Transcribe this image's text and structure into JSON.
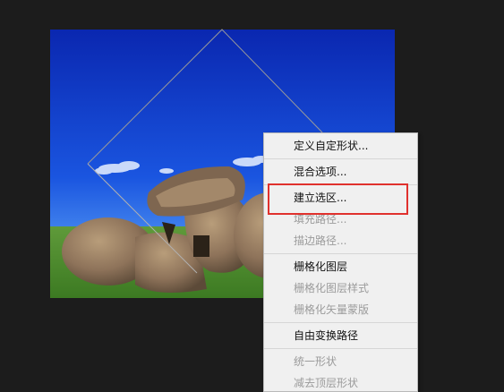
{
  "context_menu": {
    "groups": [
      [
        {
          "label": "定义自定形状...",
          "enabled": true
        }
      ],
      [
        {
          "label": "混合选项...",
          "enabled": true
        }
      ],
      [
        {
          "label": "建立选区...",
          "enabled": true,
          "highlighted": true
        },
        {
          "label": "填充路径...",
          "enabled": false
        },
        {
          "label": "描边路径...",
          "enabled": false
        }
      ],
      [
        {
          "label": "栅格化图层",
          "enabled": true
        },
        {
          "label": "栅格化图层样式",
          "enabled": false
        },
        {
          "label": "栅格化矢量蒙版",
          "enabled": false
        }
      ],
      [
        {
          "label": "自由变换路径",
          "enabled": true
        }
      ],
      [
        {
          "label": "统一形状",
          "enabled": false
        },
        {
          "label": "减去顶层形状",
          "enabled": false
        }
      ]
    ]
  },
  "colors": {
    "workspace_bg": "#1c1c1c",
    "menu_bg": "#f0f0f0",
    "highlight_border": "#e0312d",
    "sky_top": "#0a2fb8",
    "grass": "#4e8c2e"
  },
  "photo": {
    "subject": "stone dolmen on grass under blue sky"
  }
}
